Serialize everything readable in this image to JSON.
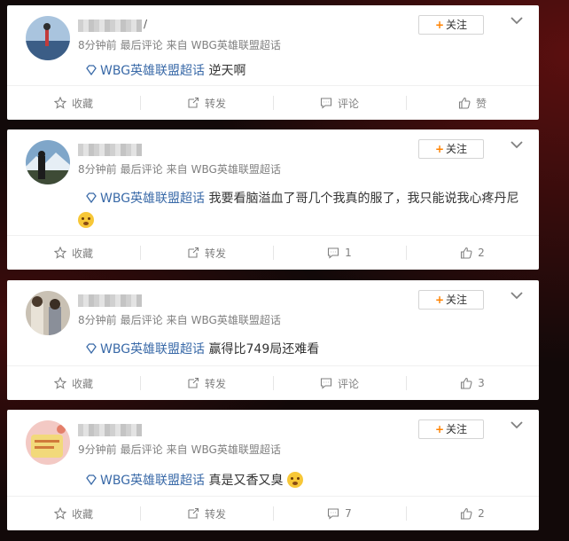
{
  "posts": [
    {
      "time": "8分钟前",
      "last_comment": "最后评论",
      "source_prefix": "来自",
      "source": "WBG英雄联盟超话",
      "follow_label": "关注",
      "topic": "WBG英雄联盟超话",
      "text": "逆天啊",
      "actions": {
        "collect": "收藏",
        "repost": "转发",
        "comment": "评论",
        "like": "赞"
      }
    },
    {
      "time": "8分钟前",
      "last_comment": "最后评论",
      "source_prefix": "来自",
      "source": "WBG英雄联盟超话",
      "follow_label": "关注",
      "topic": "WBG英雄联盟超话",
      "text": "我要看脑溢血了哥几个我真的服了，我只能说我心疼丹尼",
      "actions": {
        "collect": "收藏",
        "repost": "转发",
        "comment": "1",
        "like": "2"
      }
    },
    {
      "time": "8分钟前",
      "last_comment": "最后评论",
      "source_prefix": "来自",
      "source": "WBG英雄联盟超话",
      "follow_label": "关注",
      "topic": "WBG英雄联盟超话",
      "text": "赢得比749局还难看",
      "actions": {
        "collect": "收藏",
        "repost": "转发",
        "comment": "评论",
        "like": "3"
      }
    },
    {
      "time": "9分钟前",
      "last_comment": "最后评论",
      "source_prefix": "来自",
      "source": "WBG英雄联盟超话",
      "follow_label": "关注",
      "topic": "WBG英雄联盟超话",
      "text": "真是又香又臭",
      "actions": {
        "collect": "收藏",
        "repost": "转发",
        "comment": "7",
        "like": "2"
      }
    }
  ],
  "colors": {
    "accent": "#ff8200",
    "topic": "#3a6aa8",
    "meta": "#808080"
  }
}
